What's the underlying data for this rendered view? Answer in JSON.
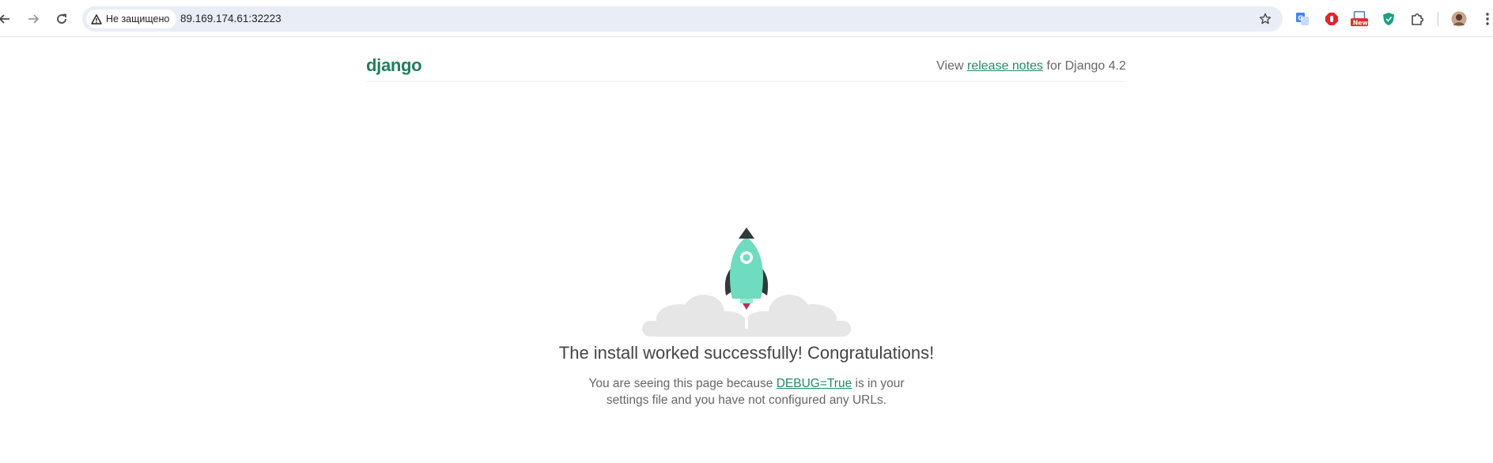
{
  "browser": {
    "security_label": "Не защищено",
    "url": "89.169.174.61:32223",
    "extension_new_badge": "New",
    "colors": {
      "omnibox_bg": "#e9eef6",
      "toolbar_icon": "#474747"
    }
  },
  "page": {
    "logo": "django",
    "release_prefix": "View ",
    "release_link": "release notes",
    "release_suffix": " for Django 4.2",
    "headline": "The install worked successfully! Congratulations!",
    "desc_prefix": "You are seeing this page because ",
    "desc_link": "DEBUG=True",
    "desc_suffix": " is in your settings file and you have not configured any URLs.",
    "colors": {
      "brand": "#1f7e5c",
      "link": "#1f8d64",
      "rocket": "#6fdbbf",
      "cloud": "#e6e6e6",
      "text": "#666666"
    }
  },
  "icons": {
    "back": "back-arrow-icon",
    "forward": "forward-arrow-icon",
    "reload": "reload-icon",
    "warning": "warning-triangle-icon",
    "bookmark": "star-icon",
    "translate": "translate-icon",
    "adblock": "stop-hand-icon",
    "new_ext": "new-badge-icon",
    "shield": "shield-icon",
    "extensions": "puzzle-icon",
    "profile": "avatar-icon",
    "menu": "more-vert-icon"
  }
}
